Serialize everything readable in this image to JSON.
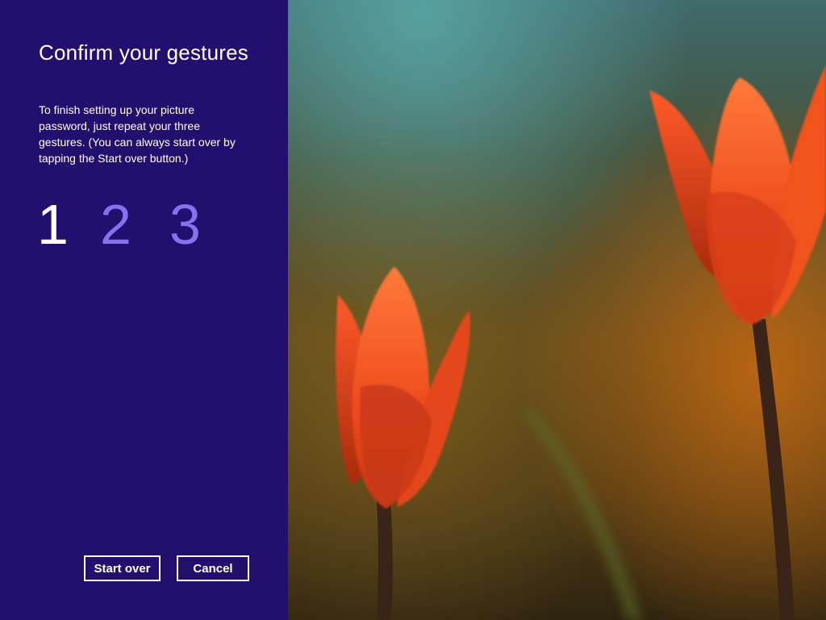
{
  "panel": {
    "title": "Confirm your gestures",
    "description": "To finish setting up your picture password, just repeat your three gestures. (You can always start over by tapping the Start over button.)",
    "steps": [
      "1",
      "2",
      "3"
    ],
    "active_step": 1,
    "colors": {
      "background": "#230f6e",
      "active_step": "#ffffff",
      "inactive_step": "#8a6ff0"
    }
  },
  "buttons": {
    "start_over": "Start over",
    "cancel": "Cancel"
  },
  "picture": {
    "subject": "two-orange-tulips-photo"
  }
}
